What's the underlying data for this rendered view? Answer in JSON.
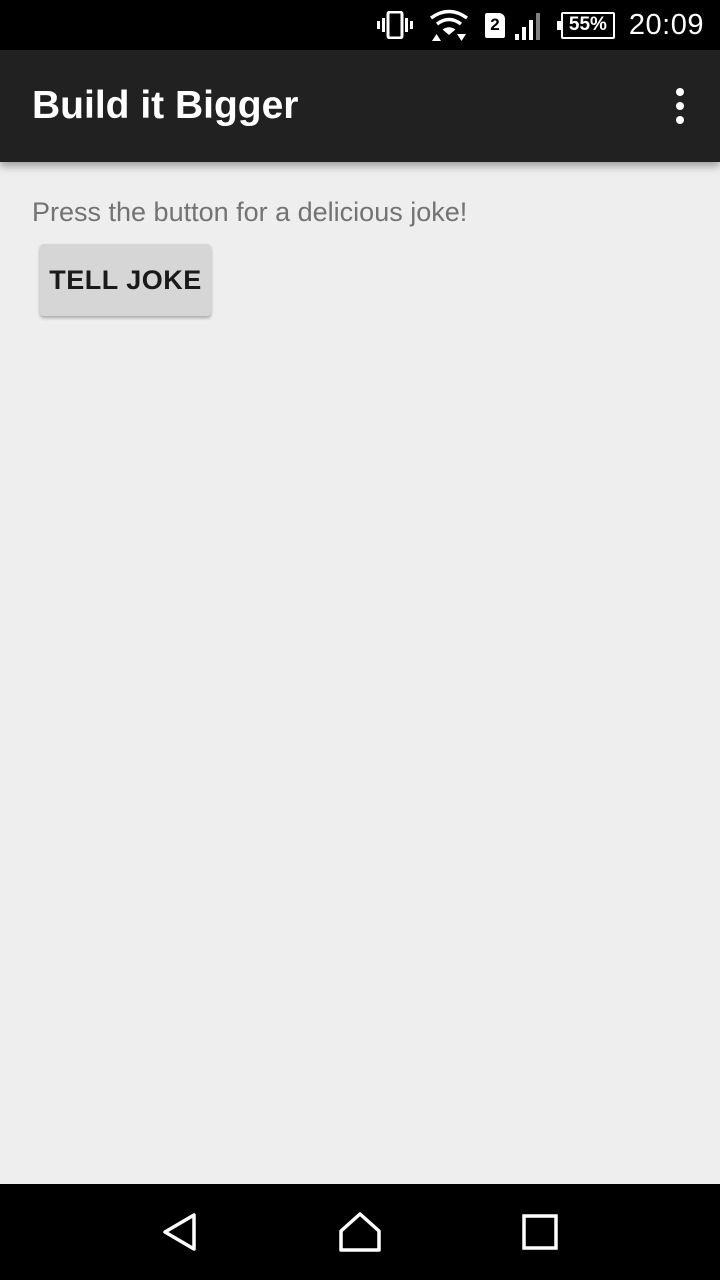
{
  "status_bar": {
    "sim_slot": "2",
    "battery": "55%",
    "time": "20:09",
    "icons": [
      "vibrate-icon",
      "wifi-icon",
      "sim-icon",
      "signal-icon",
      "battery-icon"
    ]
  },
  "app_bar": {
    "title": "Build it Bigger",
    "overflow_icon": "more-vert-icon"
  },
  "main": {
    "instructions": "Press the button for a delicious joke!",
    "tell_joke_label": "TELL JOKE"
  },
  "nav_bar": {
    "icons": [
      "back-icon",
      "home-icon",
      "recents-icon"
    ]
  },
  "colors": {
    "status_bar": "#000000",
    "app_bar": "#212121",
    "background": "#eeeeee",
    "button": "#d6d6d6",
    "instruction_text": "#737373"
  }
}
